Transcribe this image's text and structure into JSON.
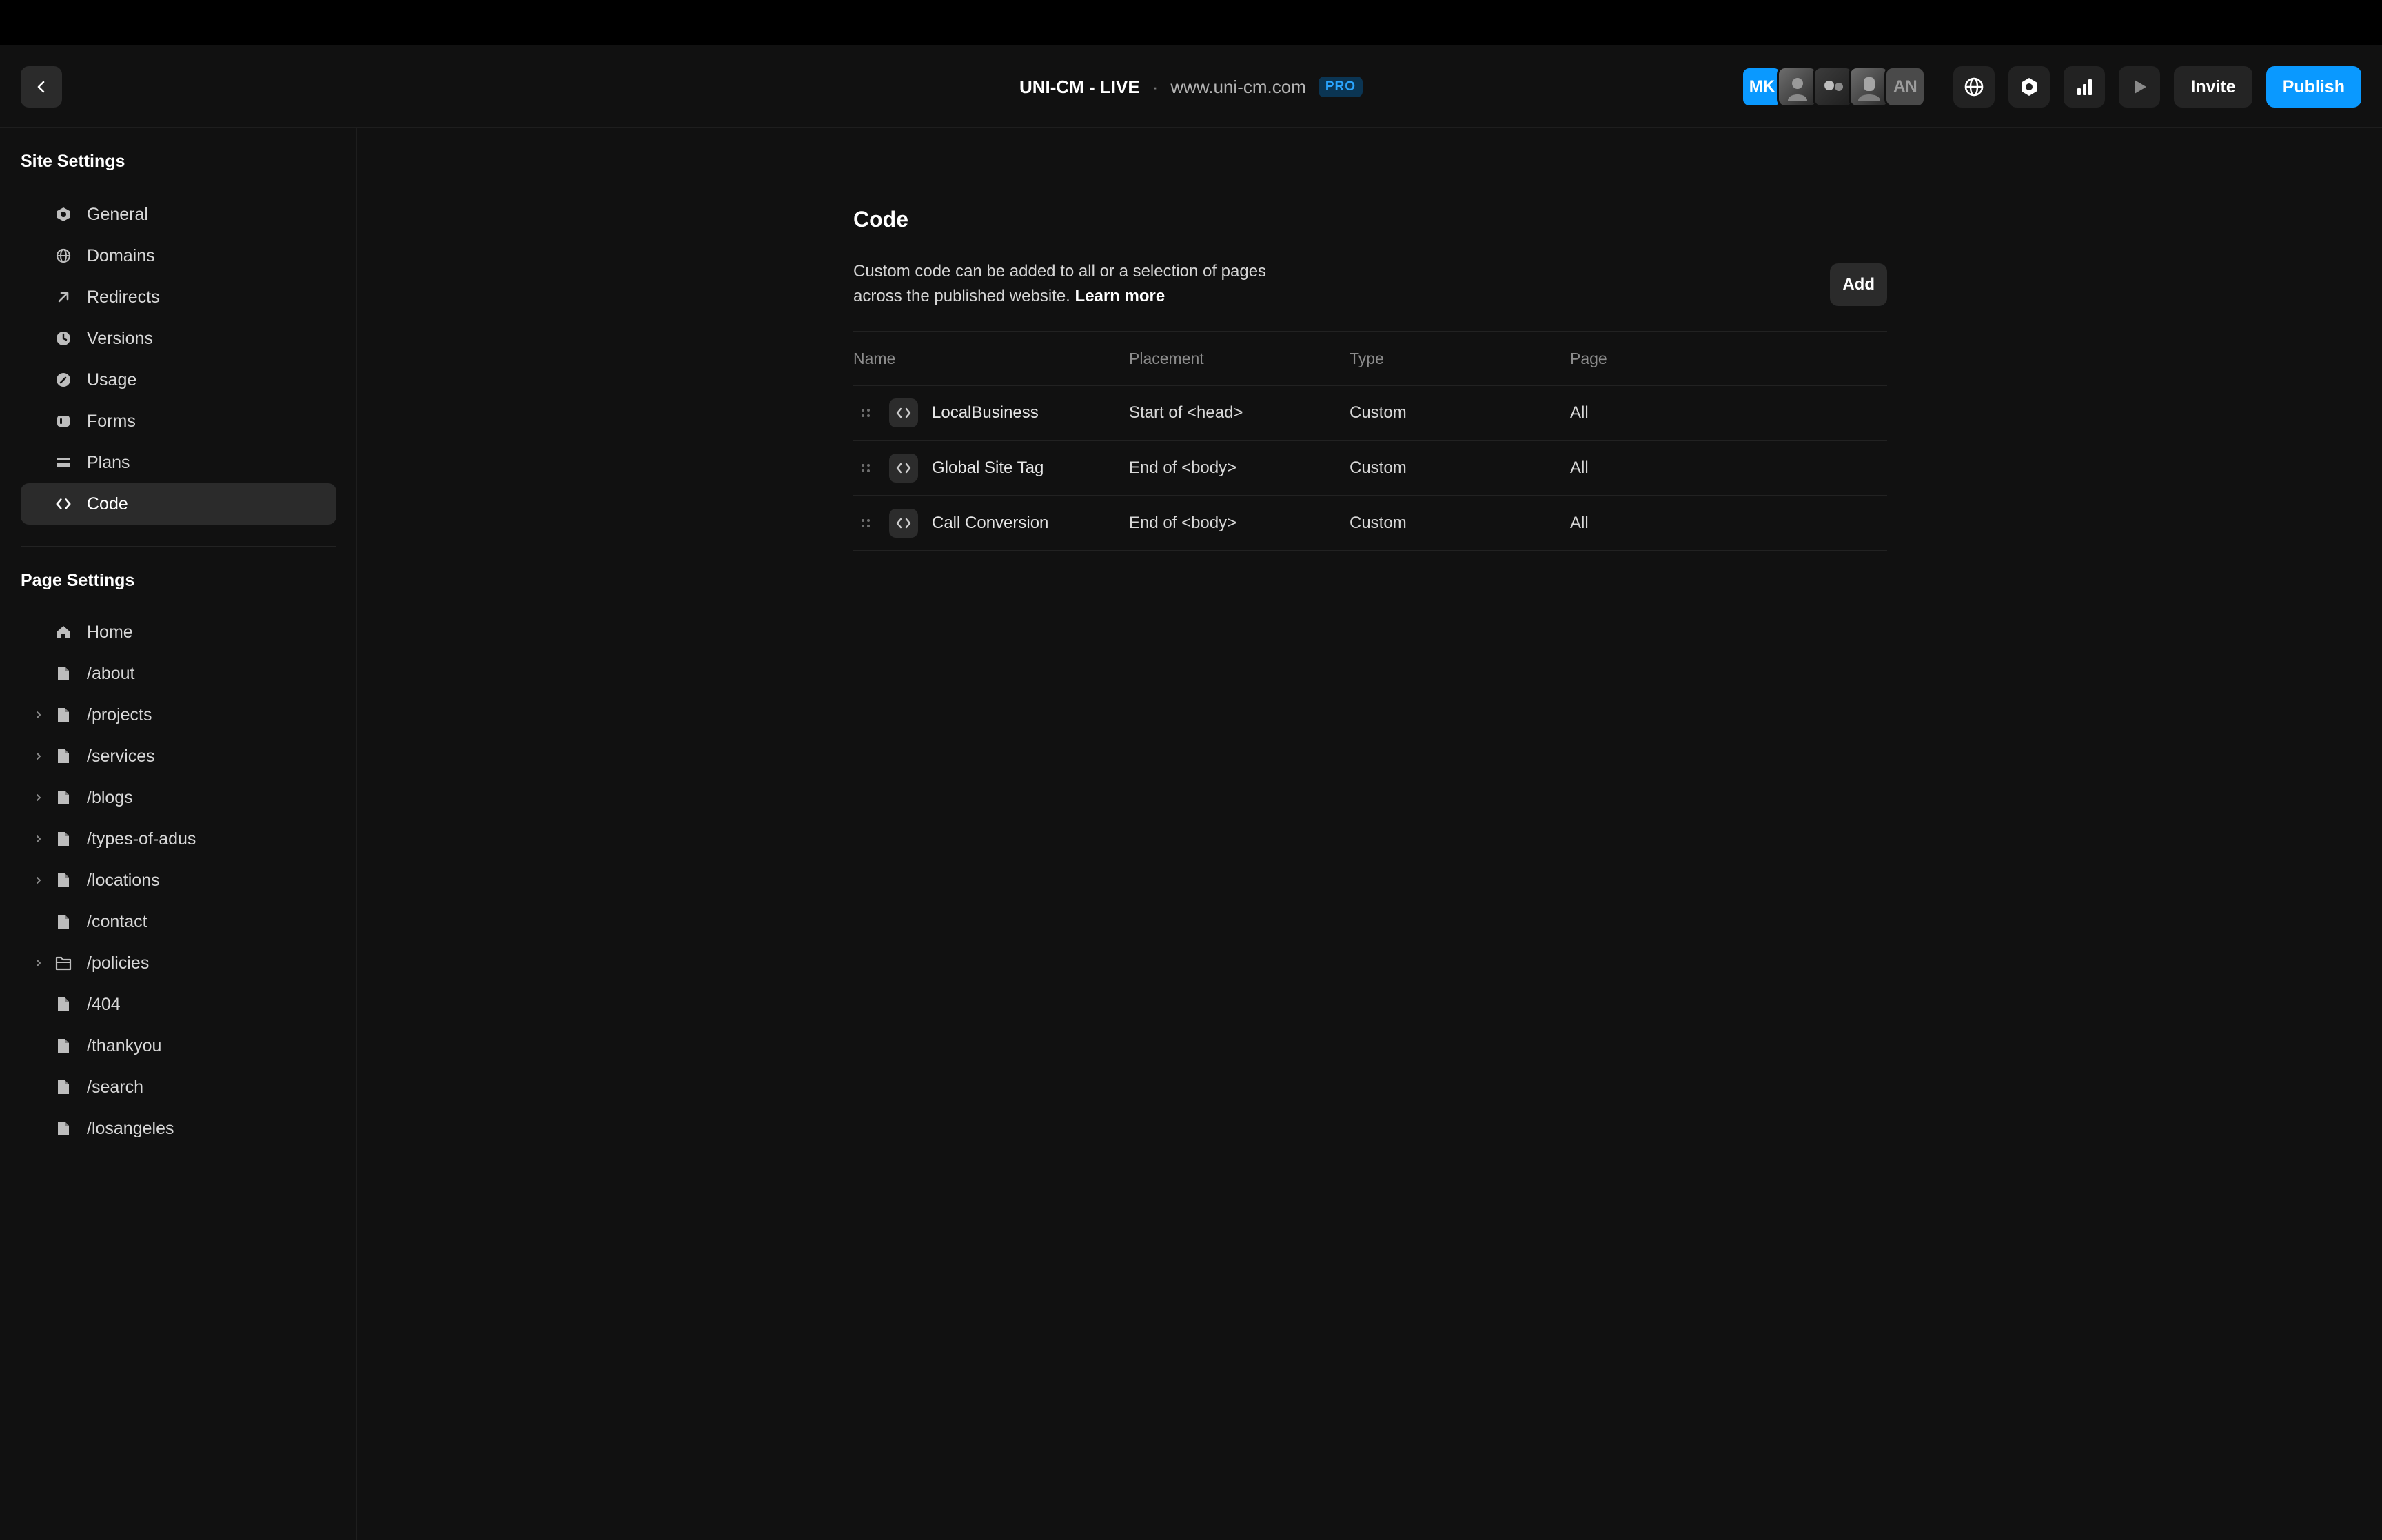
{
  "header": {
    "site_name": "UNI-CM - LIVE",
    "separator": "·",
    "site_url": "www.uni-cm.com",
    "plan_badge": "PRO",
    "avatars": [
      "MK",
      "",
      "",
      "",
      "AN"
    ],
    "invite_label": "Invite",
    "publish_label": "Publish"
  },
  "sidebar": {
    "site_settings_title": "Site Settings",
    "site_items": [
      {
        "label": "General",
        "icon": "gear-icon"
      },
      {
        "label": "Domains",
        "icon": "globe-icon"
      },
      {
        "label": "Redirects",
        "icon": "arrow-up-right-icon"
      },
      {
        "label": "Versions",
        "icon": "clock-icon"
      },
      {
        "label": "Usage",
        "icon": "gauge-icon"
      },
      {
        "label": "Forms",
        "icon": "form-icon"
      },
      {
        "label": "Plans",
        "icon": "card-icon"
      },
      {
        "label": "Code",
        "icon": "code-icon",
        "active": true
      }
    ],
    "page_settings_title": "Page Settings",
    "page_items": [
      {
        "label": "Home",
        "icon": "home-icon",
        "expandable": false
      },
      {
        "label": "/about",
        "icon": "file-icon",
        "expandable": false
      },
      {
        "label": "/projects",
        "icon": "file-icon",
        "expandable": true
      },
      {
        "label": "/services",
        "icon": "file-icon",
        "expandable": true
      },
      {
        "label": "/blogs",
        "icon": "file-icon",
        "expandable": true
      },
      {
        "label": "/types-of-adus",
        "icon": "file-icon",
        "expandable": true
      },
      {
        "label": "/locations",
        "icon": "file-icon",
        "expandable": true
      },
      {
        "label": "/contact",
        "icon": "file-icon",
        "expandable": false
      },
      {
        "label": "/policies",
        "icon": "folder-icon",
        "expandable": true
      },
      {
        "label": "/404",
        "icon": "file-icon",
        "expandable": false
      },
      {
        "label": "/thankyou",
        "icon": "file-icon",
        "expandable": false
      },
      {
        "label": "/search",
        "icon": "file-icon",
        "expandable": false
      },
      {
        "label": "/losangeles",
        "icon": "file-icon",
        "expandable": false
      }
    ]
  },
  "main": {
    "title": "Code",
    "description": "Custom code can be added to all or a selection of pages across the published website.",
    "learn_more": "Learn more",
    "add_label": "Add",
    "columns": [
      "Name",
      "Placement",
      "Type",
      "Page"
    ],
    "rows": [
      {
        "name": "LocalBusiness",
        "placement": "Start of <head>",
        "type": "Custom",
        "page": "All"
      },
      {
        "name": "Global Site Tag",
        "placement": "End of <body>",
        "type": "Custom",
        "page": "All"
      },
      {
        "name": "Call Conversion",
        "placement": "End of <body>",
        "type": "Custom",
        "page": "All"
      }
    ]
  },
  "colors": {
    "accent": "#0a99ff",
    "background": "#111111",
    "active_item": "#2b2b2b"
  }
}
